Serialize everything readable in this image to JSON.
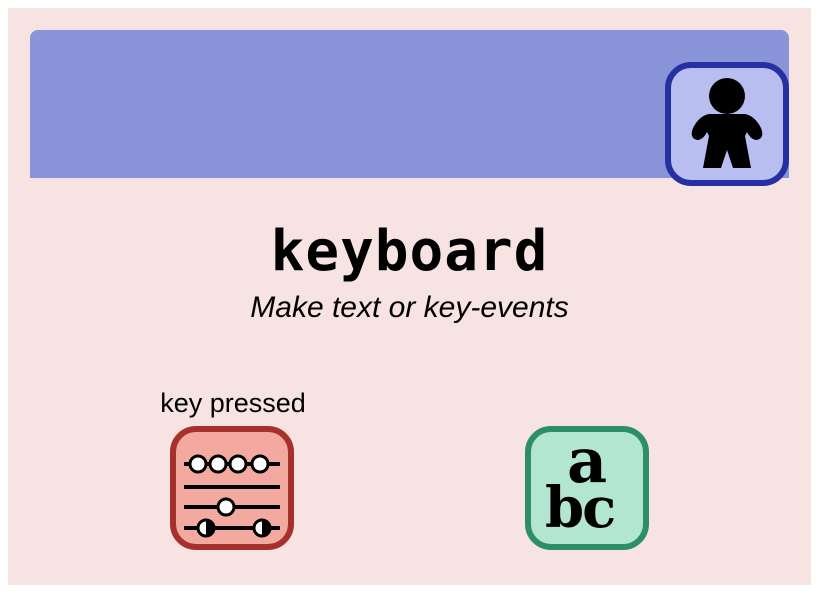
{
  "app": {
    "title": "keyboard",
    "subtitle": "Make text or key-events"
  },
  "header": {
    "avatar_icon": "person-icon"
  },
  "blocks": {
    "counter_label": "key pressed",
    "counter_icon": "abacus-icon",
    "text_icon": "abc-icon",
    "text_glyph_a": "a",
    "text_glyph_bc": "bc"
  },
  "colors": {
    "background": "#f7e3e2",
    "header": "#8a94d9",
    "avatar_fill": "#b9bef0",
    "avatar_border": "#2530a3",
    "counter_fill": "#f3a9a0",
    "counter_border": "#a8302a",
    "text_fill": "#b3e6d1",
    "text_border": "#2e8f66"
  }
}
